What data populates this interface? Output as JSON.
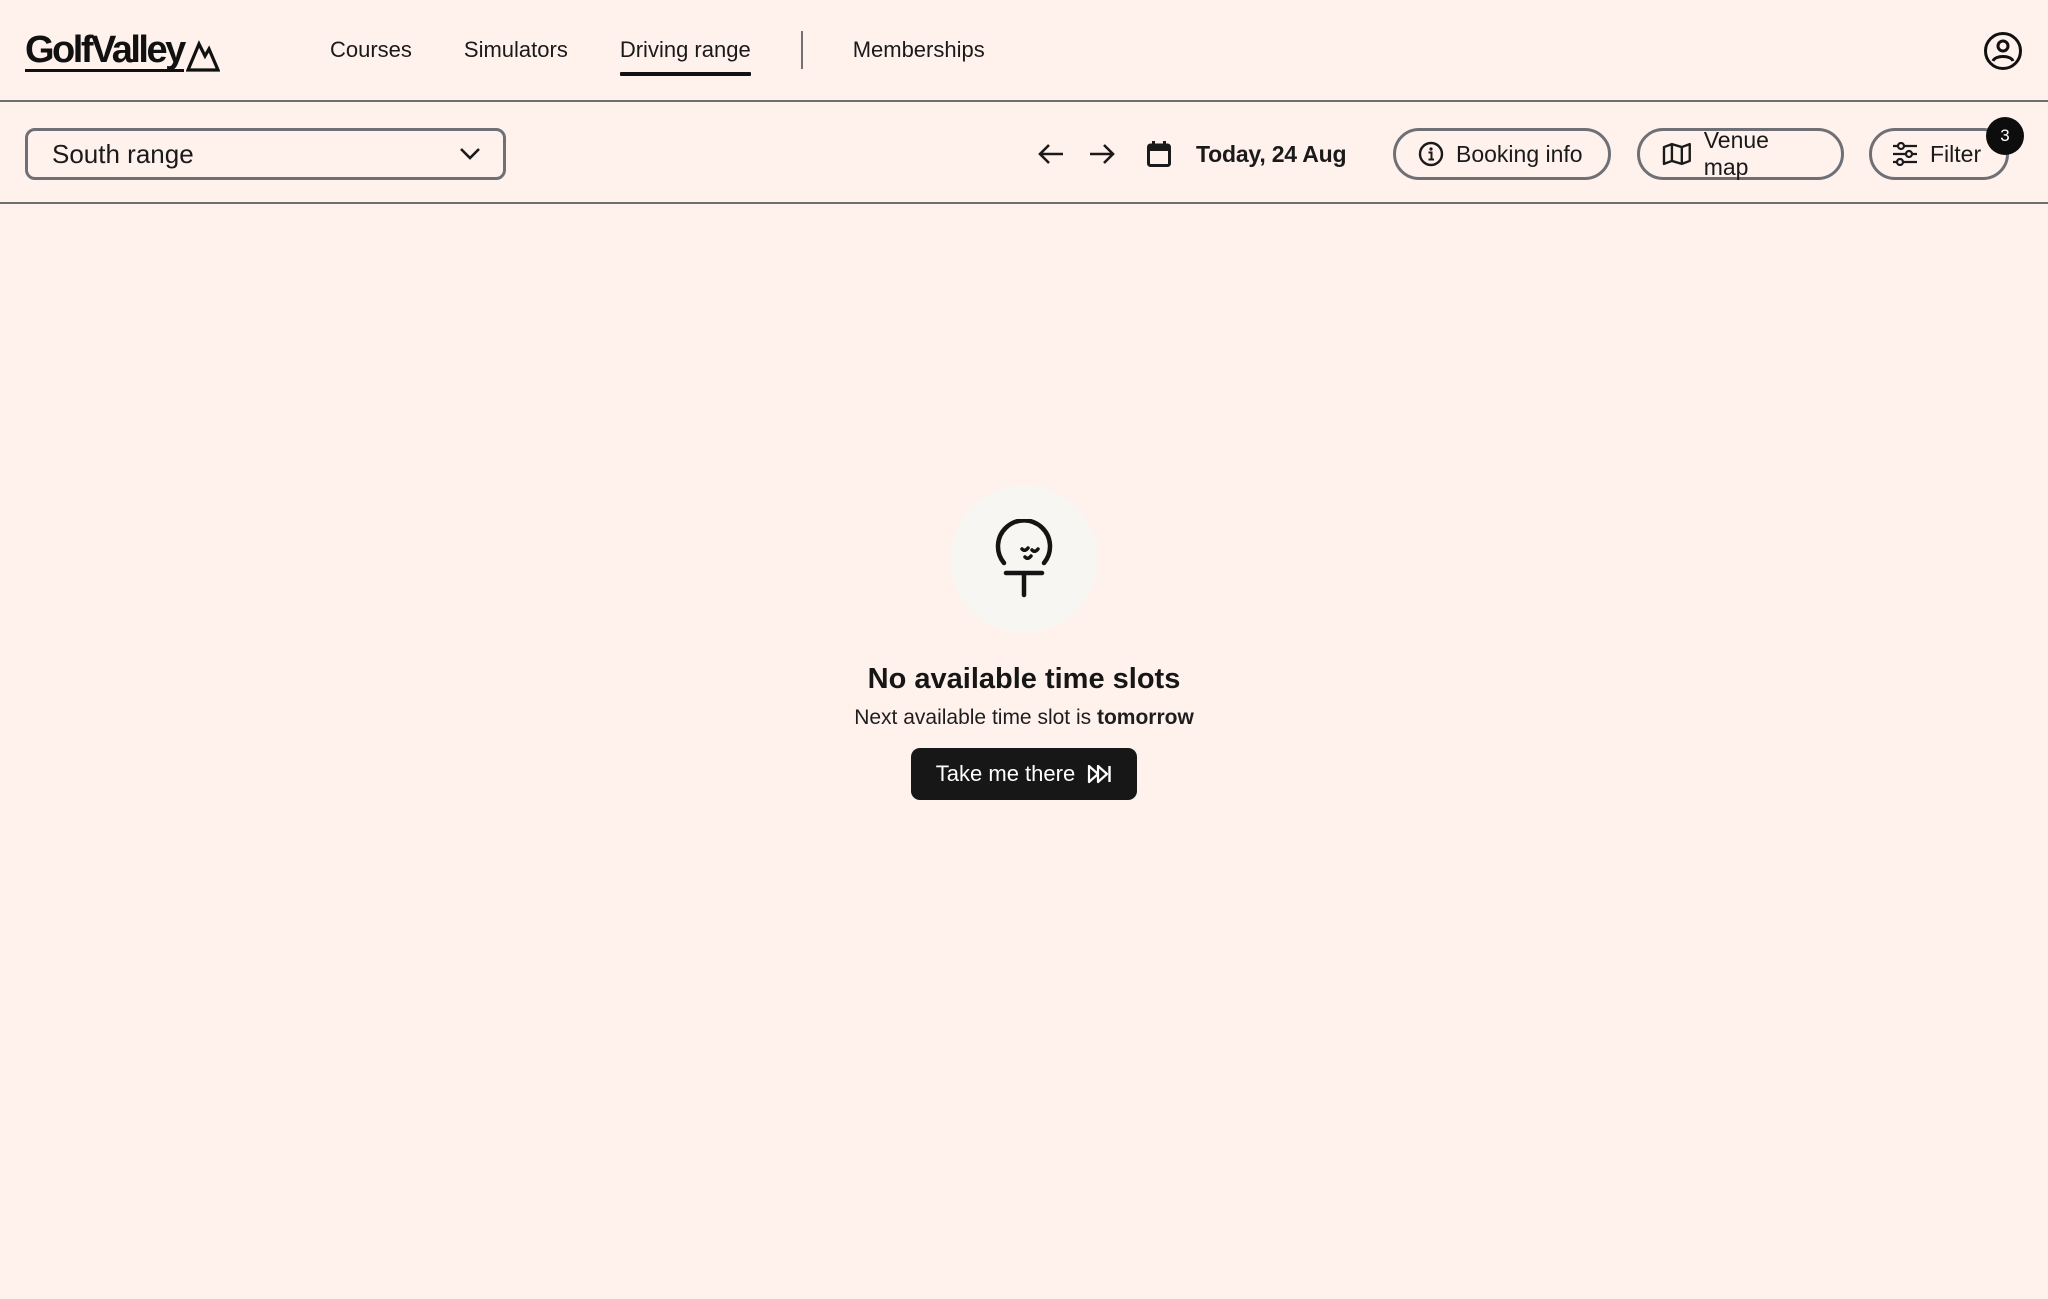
{
  "brand": {
    "name": "GolfValley",
    "logo_icon": "mountain-icon"
  },
  "nav": {
    "items": [
      {
        "label": "Courses",
        "active": false
      },
      {
        "label": "Simulators",
        "active": false
      },
      {
        "label": "Driving range",
        "active": true
      },
      {
        "label": "Memberships",
        "active": false
      }
    ],
    "account_icon": "user-circle-icon"
  },
  "toolbar": {
    "location_select": {
      "value": "South range",
      "icon": "chevron-down-icon"
    },
    "prev_icon": "arrow-left-icon",
    "next_icon": "arrow-right-icon",
    "date": {
      "icon": "calendar-icon",
      "label": "Today, 24 Aug"
    },
    "booking_info": {
      "label": "Booking info",
      "icon": "info-icon"
    },
    "venue_map": {
      "label": "Venue map",
      "icon": "map-icon"
    },
    "filter": {
      "label": "Filter",
      "icon": "sliders-icon",
      "badge_count": "3"
    }
  },
  "empty_state": {
    "icon": "golf-ball-on-tee-icon",
    "title": "No available time slots",
    "subtitle_prefix": "Next available time slot is",
    "subtitle_emphasis": "tomorrow",
    "cta": {
      "label": "Take me there",
      "icon": "skip-forward-icon"
    }
  },
  "colors": {
    "background": "#fff1ec",
    "text": "#141414",
    "border": "#6e7076",
    "cta_background": "#171717",
    "badge_background": "#0d0d0d",
    "icon_circle": "#f8f6f2"
  }
}
